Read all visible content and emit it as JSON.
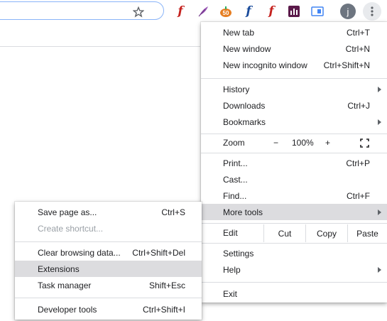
{
  "toolbar": {
    "profile_initial": "j",
    "extensions": [
      {
        "icon": "red-f-icon",
        "glyph": "f",
        "color": "#c5221f"
      },
      {
        "icon": "feather-icon",
        "glyph": "",
        "color": "#8e44ad"
      },
      {
        "icon": "pumpkin-icon",
        "glyph": "",
        "color": "#e67e22"
      },
      {
        "icon": "blue-f-icon",
        "glyph": "f",
        "color": "#1a4b9b"
      },
      {
        "icon": "red-f-icon",
        "glyph": "f",
        "color": "#c5221f"
      },
      {
        "icon": "purple-chart-icon",
        "glyph": "",
        "color": "#5b1a4a"
      },
      {
        "icon": "blue-card-icon",
        "glyph": "",
        "color": "#4285f4"
      }
    ]
  },
  "main_menu": {
    "new_tab": "New tab",
    "new_tab_sc": "Ctrl+T",
    "new_window": "New window",
    "new_window_sc": "Ctrl+N",
    "new_incognito": "New incognito window",
    "new_incognito_sc": "Ctrl+Shift+N",
    "history": "History",
    "downloads": "Downloads",
    "downloads_sc": "Ctrl+J",
    "bookmarks": "Bookmarks",
    "zoom": "Zoom",
    "zoom_minus": "−",
    "zoom_level": "100%",
    "zoom_plus": "+",
    "print": "Print...",
    "print_sc": "Ctrl+P",
    "cast": "Cast...",
    "find": "Find...",
    "find_sc": "Ctrl+F",
    "more_tools": "More tools",
    "edit": "Edit",
    "cut": "Cut",
    "copy": "Copy",
    "paste": "Paste",
    "settings": "Settings",
    "help": "Help",
    "exit": "Exit"
  },
  "sub_menu": {
    "save_page": "Save page as...",
    "save_page_sc": "Ctrl+S",
    "create_shortcut": "Create shortcut...",
    "clear_browsing": "Clear browsing data...",
    "clear_browsing_sc": "Ctrl+Shift+Del",
    "extensions": "Extensions",
    "task_manager": "Task manager",
    "task_manager_sc": "Shift+Esc",
    "developer_tools": "Developer tools",
    "developer_tools_sc": "Ctrl+Shift+I"
  }
}
